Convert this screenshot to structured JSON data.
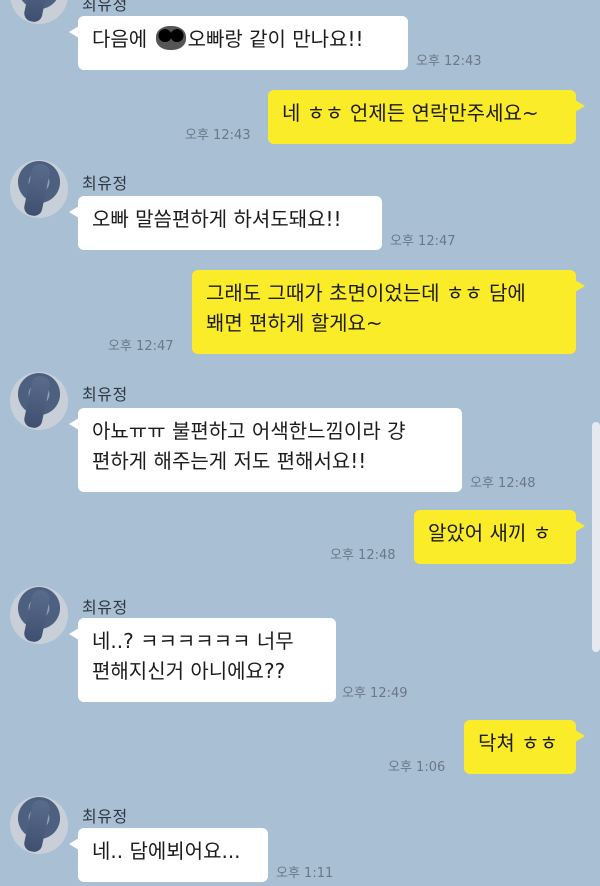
{
  "contact_name": "최유정",
  "messages": [
    {
      "from": "them",
      "text_before": "다음에 ",
      "text_after": "오빠랑 같이 만나요!!",
      "time": "오후 12:43"
    },
    {
      "from": "me",
      "text": "네 ㅎㅎ 언제든 연락만주세요~",
      "time": "오후 12:43"
    },
    {
      "from": "them",
      "text": "오빠 말씀편하게 하셔도돼요!!",
      "time": "오후 12:47"
    },
    {
      "from": "me",
      "lines": [
        "그래도 그때가 초면이었는데 ㅎㅎ 담에",
        "봬면 편하게 할게요~"
      ],
      "time": "오후 12:47"
    },
    {
      "from": "them",
      "lines": [
        "아뇨ㅠㅠ 불편하고 어색한느낌이라 걍",
        "편하게 해주는게 저도 편해서요!!"
      ],
      "time": "오후 12:48"
    },
    {
      "from": "me",
      "text": "알았어 새끼 ㅎ",
      "time": "오후 12:48"
    },
    {
      "from": "them",
      "lines": [
        "네..? ㅋㅋㅋㅋㅋㅋ 너무",
        "편해지신거 아니에요??"
      ],
      "time": "오후 12:49"
    },
    {
      "from": "me",
      "text": "닥쳐 ㅎㅎ",
      "time": "오후 1:06"
    },
    {
      "from": "them",
      "text": "네.. 담에뵈어요...",
      "time": "오후 1:11"
    }
  ],
  "icons": {
    "avatar": "profile-avatar",
    "emoji": "blurred-emoji"
  },
  "colors": {
    "background": "#a9c0d4",
    "incoming": "#ffffff",
    "outgoing": "#fbec2a"
  }
}
